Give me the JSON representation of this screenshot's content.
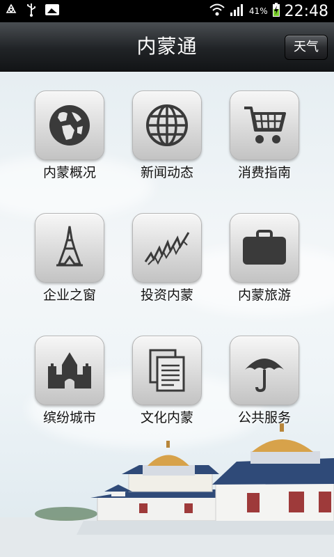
{
  "status_bar": {
    "battery_percent": "41%",
    "time": "22:48"
  },
  "header": {
    "title": "内蒙通",
    "weather_button": "天气"
  },
  "menu": [
    {
      "label": "内蒙概况",
      "icon": "globe-icon"
    },
    {
      "label": "新闻动态",
      "icon": "world-grid-icon"
    },
    {
      "label": "消费指南",
      "icon": "shopping-cart-icon"
    },
    {
      "label": "企业之窗",
      "icon": "eiffel-tower-icon"
    },
    {
      "label": "投资内蒙",
      "icon": "stock-chart-icon"
    },
    {
      "label": "内蒙旅游",
      "icon": "suitcase-icon"
    },
    {
      "label": "缤纷城市",
      "icon": "castle-icon"
    },
    {
      "label": "文化内蒙",
      "icon": "documents-icon"
    },
    {
      "label": "公共服务",
      "icon": "umbrella-icon"
    }
  ],
  "colors": {
    "title_bar": "#1e2124",
    "icon_glyph": "#3a3a3a",
    "roof_gold": "#d7a24a",
    "roof_blue": "#2f4a78"
  }
}
